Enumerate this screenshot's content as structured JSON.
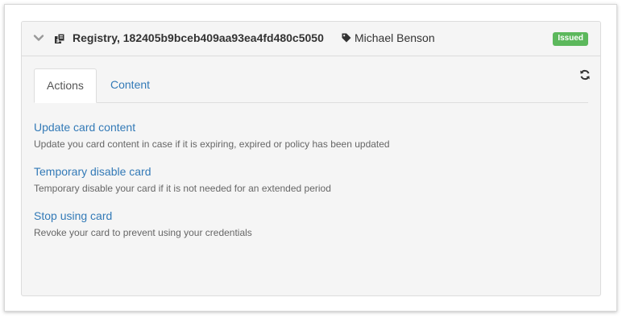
{
  "card": {
    "title": "Registry, 182405b9bceb409aa93ea4fd480c5050",
    "owner": "Michael Benson",
    "status": "Issued",
    "status_color": "#5cb85c",
    "icons": {
      "collapse": "chevron-down-icon",
      "registry": "certificate-icon",
      "owner": "tag-icon",
      "refresh": "refresh-icon"
    }
  },
  "tabs": [
    {
      "label": "Actions",
      "active": true
    },
    {
      "label": "Content",
      "active": false
    }
  ],
  "actions": [
    {
      "label": "Update card content",
      "description": "Update you card content in case if it is expiring, expired or policy has been updated"
    },
    {
      "label": "Temporary disable card",
      "description": "Temporary disable your card if it is not needed for an extended period"
    },
    {
      "label": "Stop using card",
      "description": "Revoke your card to prevent using your credentials"
    }
  ],
  "colors": {
    "link": "#337ab7",
    "panel_bg": "#f5f5f5"
  }
}
